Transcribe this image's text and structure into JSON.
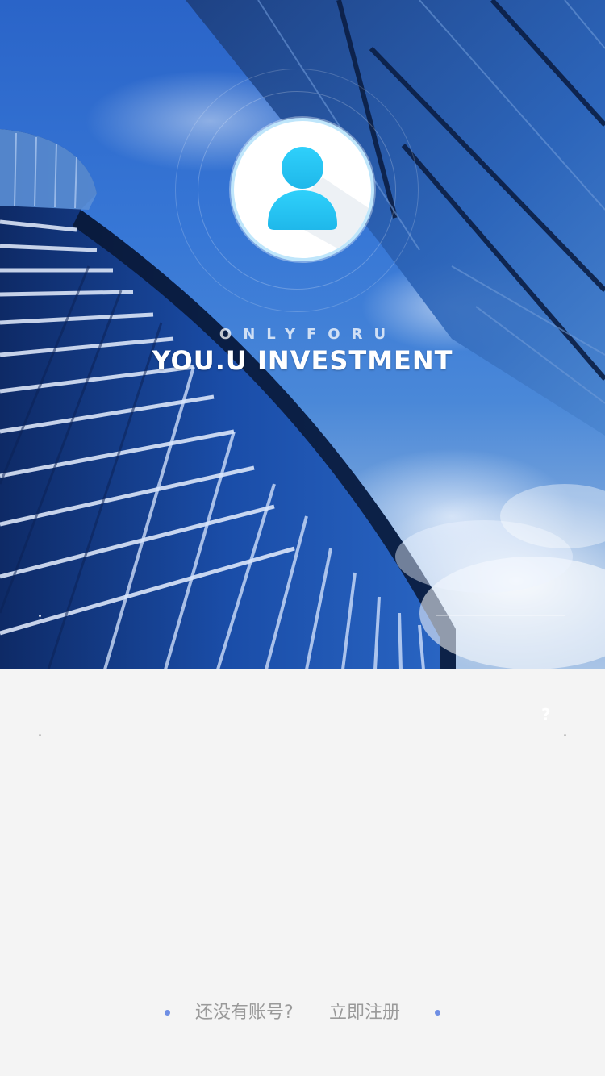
{
  "hero": {
    "tagline": "ONLYFORU",
    "brand": "YOU.U INVESTMENT",
    "avatar_icon": "user-icon",
    "accent_color": "#22c3f4"
  },
  "login_help": {
    "mark": "?"
  },
  "register": {
    "prompt": "还没有账号?",
    "link": "立即注册",
    "dot_color": "#6f8fe4"
  }
}
